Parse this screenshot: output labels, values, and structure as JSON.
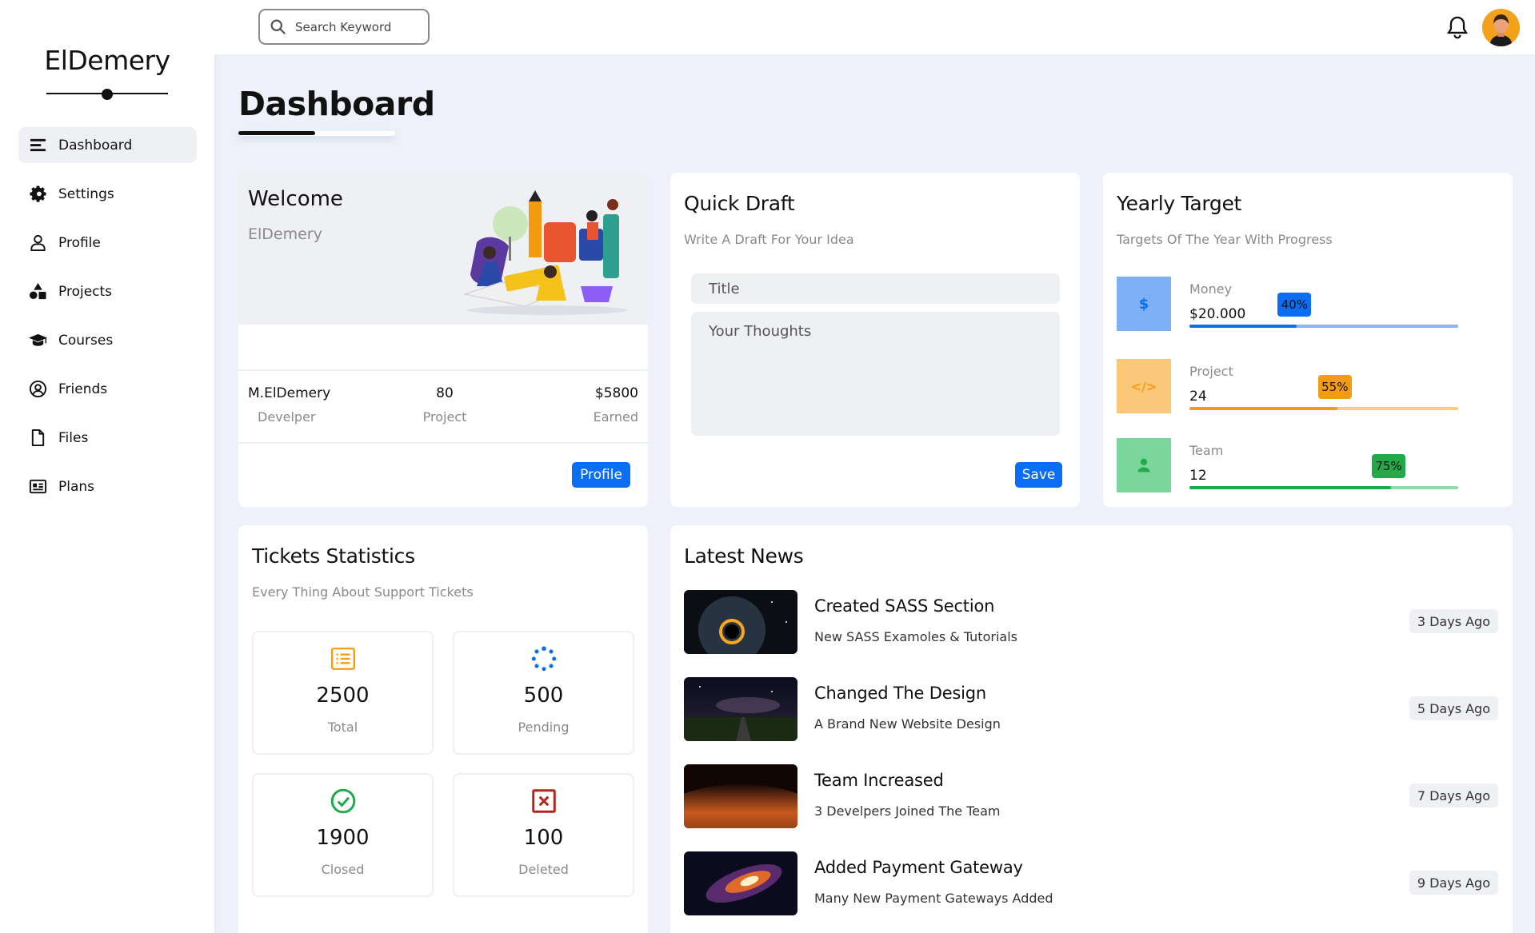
{
  "brand": "ElDemery",
  "search": {
    "placeholder": "Search Keyword"
  },
  "nav": [
    {
      "label": "Dashboard",
      "icon": "menu-icon"
    },
    {
      "label": "Settings",
      "icon": "gear-icon"
    },
    {
      "label": "Profile",
      "icon": "user-icon"
    },
    {
      "label": "Projects",
      "icon": "shapes-icon"
    },
    {
      "label": "Courses",
      "icon": "graduation-cap-icon"
    },
    {
      "label": "Friends",
      "icon": "user-circle-icon"
    },
    {
      "label": "Files",
      "icon": "file-icon"
    },
    {
      "label": "Plans",
      "icon": "newspaper-icon"
    }
  ],
  "page_title": "Dashboard",
  "welcome": {
    "title": "Welcome",
    "name": "ElDemery",
    "stats": [
      {
        "value": "M.ElDemery",
        "label": "Develper"
      },
      {
        "value": "80",
        "label": "Project"
      },
      {
        "value": "$5800",
        "label": "Earned"
      }
    ],
    "button": "Profile"
  },
  "draft": {
    "title": "Quick Draft",
    "subtitle": "Write A Draft For Your Idea",
    "title_placeholder": "Title",
    "body_placeholder": "Your Thoughts",
    "button": "Save"
  },
  "target": {
    "title": "Yearly Target",
    "subtitle": "Targets Of The Year With Progress",
    "rows": [
      {
        "label": "Money",
        "value": "$20.000",
        "percent": 40,
        "badge": "40%",
        "icon": "$",
        "color": "#0b6cf4",
        "light": "#7eb0f8",
        "bar_light": "#8fb4f5"
      },
      {
        "label": "Project",
        "value": "24",
        "percent": 55,
        "badge": "55%",
        "icon": "</>",
        "color": "#f39c12",
        "light": "#fbc87a",
        "bar_light": "#f8cc86"
      },
      {
        "label": "Team",
        "value": "12",
        "percent": 75,
        "badge": "75%",
        "icon": "user",
        "color": "#22a94a",
        "light": "#7ad69a",
        "bar_light": "#8fdcaa"
      }
    ]
  },
  "tickets": {
    "title": "Tickets Statistics",
    "subtitle": "Every Thing About Support Tickets",
    "items": [
      {
        "value": "2500",
        "label": "Total",
        "icon": "list-icon",
        "color": "#f39c12"
      },
      {
        "value": "500",
        "label": "Pending",
        "icon": "spinner-icon",
        "color": "#0b6cf4"
      },
      {
        "value": "1900",
        "label": "Closed",
        "icon": "check-circle-icon",
        "color": "#22a94a"
      },
      {
        "value": "100",
        "label": "Deleted",
        "icon": "x-square-icon",
        "color": "#b3261e"
      }
    ]
  },
  "news": {
    "title": "Latest News",
    "items": [
      {
        "title": "Created SASS Section",
        "desc": "New SASS Examoles & Tutorials",
        "time": "3 Days Ago"
      },
      {
        "title": "Changed The Design",
        "desc": "A Brand New Website Design",
        "time": "5 Days Ago"
      },
      {
        "title": "Team Increased",
        "desc": "3 Develpers Joined The Team",
        "time": "7 Days Ago"
      },
      {
        "title": "Added Payment Gateway",
        "desc": "Many New Payment Gateways Added",
        "time": "9 Days Ago"
      }
    ]
  }
}
